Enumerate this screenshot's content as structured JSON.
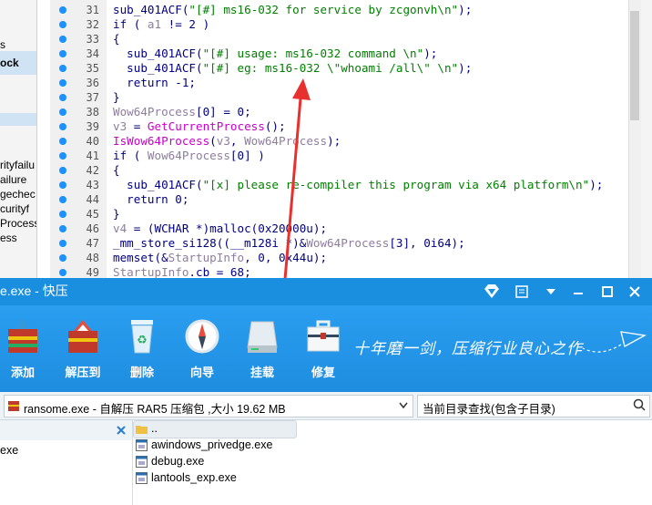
{
  "ida": {
    "left_pane_items": [
      {
        "text": "s",
        "bold": false
      },
      {
        "text": "ock",
        "bold": true
      },
      {
        "text": "rityfailu",
        "bold": false
      },
      {
        "text": "ailure",
        "bold": false
      },
      {
        "text": "gechec",
        "bold": false
      },
      {
        "text": "curityf",
        "bold": false
      },
      {
        "text": "Process",
        "bold": false
      },
      {
        "text": "ess",
        "bold": false
      }
    ],
    "lines": [
      {
        "num": "31",
        "segs": [
          {
            "t": "sub_401ACF(",
            "c": ""
          },
          {
            "t": "\"[#] ms16-032 for service by zcgonvh\\n\"",
            "c": "str"
          },
          {
            "t": ");",
            "c": ""
          }
        ]
      },
      {
        "num": "32",
        "segs": [
          {
            "t": "if ( ",
            "c": ""
          },
          {
            "t": "a1",
            "c": "var"
          },
          {
            "t": " != 2 )",
            "c": ""
          }
        ]
      },
      {
        "num": "33",
        "segs": [
          {
            "t": "{",
            "c": ""
          }
        ]
      },
      {
        "num": "34",
        "segs": [
          {
            "t": "  sub_401ACF(",
            "c": ""
          },
          {
            "t": "\"[#] usage: ms16-032 command \\n\"",
            "c": "str"
          },
          {
            "t": ");",
            "c": ""
          }
        ]
      },
      {
        "num": "35",
        "segs": [
          {
            "t": "  sub_401ACF(",
            "c": ""
          },
          {
            "t": "\"[#] eg: ms16-032 \\\"whoami /all\\\" \\n\"",
            "c": "str"
          },
          {
            "t": ");",
            "c": ""
          }
        ]
      },
      {
        "num": "36",
        "segs": [
          {
            "t": "  return -1;",
            "c": ""
          }
        ]
      },
      {
        "num": "37",
        "segs": [
          {
            "t": "}",
            "c": ""
          }
        ]
      },
      {
        "num": "38",
        "segs": [
          {
            "t": "Wow64Process",
            "c": "var"
          },
          {
            "t": "[0] = 0;",
            "c": ""
          }
        ]
      },
      {
        "num": "39",
        "segs": [
          {
            "t": "v3",
            "c": "var"
          },
          {
            "t": " = ",
            "c": ""
          },
          {
            "t": "GetCurrentProcess",
            "c": "fn"
          },
          {
            "t": "();",
            "c": ""
          }
        ]
      },
      {
        "num": "40",
        "segs": [
          {
            "t": "IsWow64Process",
            "c": "fn"
          },
          {
            "t": "(",
            "c": ""
          },
          {
            "t": "v3",
            "c": "var"
          },
          {
            "t": ", ",
            "c": ""
          },
          {
            "t": "Wow64Process",
            "c": "var"
          },
          {
            "t": ");",
            "c": ""
          }
        ]
      },
      {
        "num": "41",
        "segs": [
          {
            "t": "if ( ",
            "c": ""
          },
          {
            "t": "Wow64Process",
            "c": "var"
          },
          {
            "t": "[0] )",
            "c": ""
          }
        ]
      },
      {
        "num": "42",
        "segs": [
          {
            "t": "{",
            "c": ""
          }
        ]
      },
      {
        "num": "43",
        "segs": [
          {
            "t": "  sub_401ACF(",
            "c": ""
          },
          {
            "t": "\"[x] please re-compiler this program via x64 platform\\n\"",
            "c": "str"
          },
          {
            "t": ");",
            "c": ""
          }
        ]
      },
      {
        "num": "44",
        "segs": [
          {
            "t": "  return 0;",
            "c": ""
          }
        ]
      },
      {
        "num": "45",
        "segs": [
          {
            "t": "}",
            "c": ""
          }
        ]
      },
      {
        "num": "46",
        "segs": [
          {
            "t": "v4",
            "c": "var"
          },
          {
            "t": " = (WCHAR *)malloc(0x20000u);",
            "c": ""
          }
        ]
      },
      {
        "num": "47",
        "segs": [
          {
            "t": "_mm_store_si128((__m128i *)&",
            "c": ""
          },
          {
            "t": "Wow64Process",
            "c": "var"
          },
          {
            "t": "[3], 0i64);",
            "c": ""
          }
        ]
      },
      {
        "num": "48",
        "segs": [
          {
            "t": "memset(&",
            "c": ""
          },
          {
            "t": "StartupInfo",
            "c": "var"
          },
          {
            "t": ", 0, 0x44u);",
            "c": ""
          }
        ]
      },
      {
        "num": "49",
        "segs": [
          {
            "t": "StartupInfo",
            "c": "var"
          },
          {
            "t": ".cb = 68;",
            "c": ""
          }
        ]
      }
    ],
    "colors": {
      "string": "#008000",
      "variable": "#8e7e9e",
      "api": "#cc00cc",
      "text": "#000080",
      "breakpoint_dot": "#1e90ff"
    }
  },
  "kuaiya": {
    "title": "e.exe - 快压",
    "window_buttons": [
      "diamond-icon",
      "feedback-icon",
      "menu-icon",
      "minimize-icon",
      "maximize-icon",
      "close-icon"
    ],
    "toolbar": [
      {
        "label": "添加",
        "icon": "add-archive-icon"
      },
      {
        "label": "解压到",
        "icon": "extract-icon"
      },
      {
        "label": "删除",
        "icon": "recycle-bin-icon"
      },
      {
        "label": "向导",
        "icon": "compass-icon"
      },
      {
        "label": "挂载",
        "icon": "drive-icon"
      },
      {
        "label": "修复",
        "icon": "toolbox-icon"
      }
    ],
    "slogan": "十年磨一剑，压缩行业良心之作",
    "path_text": "ransome.exe - 自解压 RAR5 压缩包 ,大小 19.62 MB",
    "search_placeholder": "当前目录查找(包含子目录)",
    "tree_item": "exe",
    "files": [
      {
        "name": "..",
        "type": "folder"
      },
      {
        "name": "awindows_privedge.exe",
        "type": "exe"
      },
      {
        "name": "debug.exe",
        "type": "exe"
      },
      {
        "name": "lantools_exp.exe",
        "type": "exe"
      }
    ],
    "accent_color": "#1a8fe0"
  }
}
